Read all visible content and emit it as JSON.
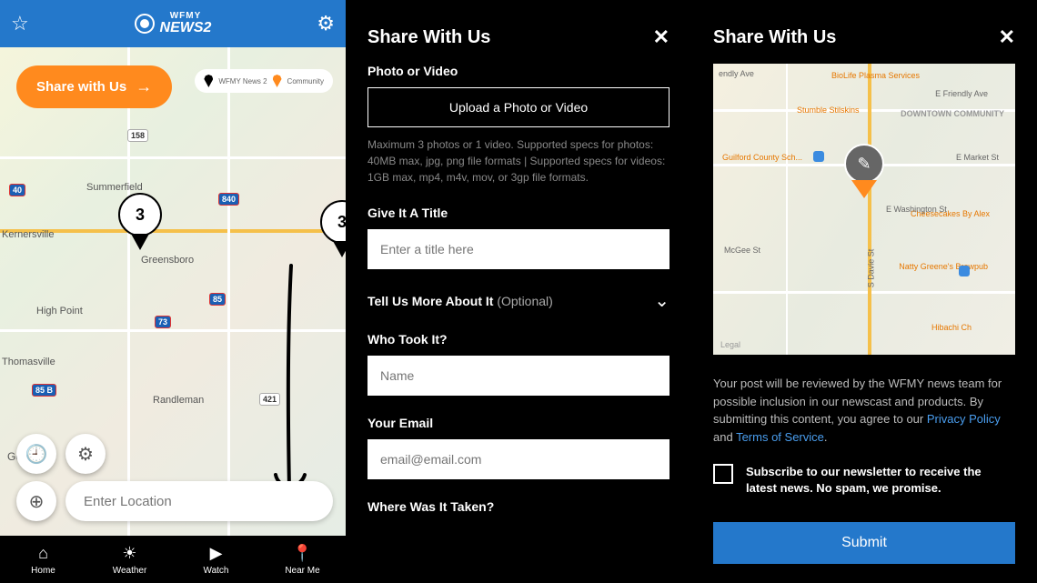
{
  "left": {
    "logo": {
      "top": "WFMY",
      "bottom": "NEWS2"
    },
    "share_button": "Share with Us",
    "legend": {
      "item1": "WFMY News 2",
      "item2": "Community"
    },
    "pins": {
      "pin1_count": "3",
      "pin2_count": "3"
    },
    "map_labels": {
      "summerfield": "Summerfield",
      "greensboro": "Greensboro",
      "kernersville": "Kernersville",
      "highpoint": "High Point",
      "thomasville": "Thomasville",
      "randleman": "Randleman"
    },
    "shields": {
      "s40a": "40",
      "s840a": "840",
      "s158": "158",
      "s73": "73",
      "s85": "85",
      "s421": "421",
      "s85b": "85 B"
    },
    "google": "Google",
    "location_placeholder": "Enter Location",
    "nav": [
      {
        "label": "Home"
      },
      {
        "label": "Weather"
      },
      {
        "label": "Watch"
      },
      {
        "label": "Near Me"
      }
    ]
  },
  "mid": {
    "title": "Share With Us",
    "photo_label": "Photo or Video",
    "upload_btn": "Upload a Photo or Video",
    "upload_hint": "Maximum 3 photos or 1 video. Supported specs for photos: 40MB max, jpg, png file formats | Supported specs for videos: 1GB max, mp4, m4v, mov, or 3gp file formats.",
    "title_label": "Give It A Title",
    "title_placeholder": "Enter a title here",
    "more_label": "Tell Us More About It",
    "more_optional": "(Optional)",
    "who_label": "Who Took It?",
    "who_placeholder": "Name",
    "email_label": "Your Email",
    "email_placeholder": "email@email.com",
    "where_label": "Where Was It Taken?"
  },
  "right": {
    "title": "Share With Us",
    "map_labels": {
      "friendly": "endly Ave",
      "biolife": "BioLife Plasma Services",
      "efriendly": "E Friendly Ave",
      "stumble": "Stumble Stilskins",
      "downtown": "DOWNTOWN COMMUNITY",
      "guilford": "Guilford County Sch...",
      "emarket": "E Market St",
      "cheesecakes": "Cheesecakes By Alex",
      "mcgee": "McGee St",
      "washington": "E Washington St",
      "sdavie": "S Davie St",
      "natty": "Natty Greene's Brewpub",
      "hibachi": "Hibachi Ch",
      "legal": "Legal"
    },
    "disclaimer_pre": "Your post will be reviewed by the WFMY news team for possible inclusion in our newscast and products. By submitting this content, you agree to our ",
    "privacy": "Privacy Policy",
    "and": " and ",
    "tos": "Terms of Service",
    "period": ".",
    "newsletter": "Subscribe to our newsletter to receive the latest news. No spam, we promise.",
    "submit": "Submit"
  }
}
